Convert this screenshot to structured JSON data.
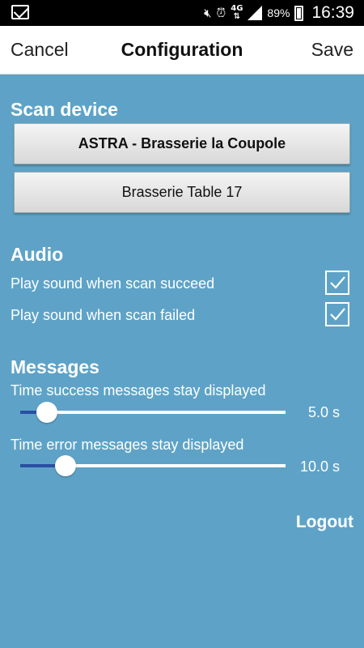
{
  "status_bar": {
    "battery_percent": "89%",
    "time": "16:39",
    "network": "4G",
    "icons": [
      "gmail-icon",
      "mute-icon",
      "alarm-icon",
      "network-4g-icon",
      "signal-icon",
      "battery-charging-icon"
    ]
  },
  "header": {
    "cancel_label": "Cancel",
    "title": "Configuration",
    "save_label": "Save"
  },
  "scan_device": {
    "title": "Scan device",
    "device_button": "ASTRA - Brasserie la Coupole",
    "table_button": "Brasserie Table 17"
  },
  "audio": {
    "title": "Audio",
    "items": [
      {
        "label": "Play sound when scan succeed",
        "checked": true
      },
      {
        "label": "Play sound when scan failed",
        "checked": true
      }
    ]
  },
  "messages": {
    "title": "Messages",
    "sliders": [
      {
        "label": "Time success messages stay displayed",
        "value": "5.0 s",
        "fraction": 0.1
      },
      {
        "label": "Time error messages stay displayed",
        "value": "10.0 s",
        "fraction": 0.17
      }
    ]
  },
  "logout_label": "Logout",
  "colors": {
    "background": "#5ea3c7",
    "slider_fill": "#2a4fa3",
    "header_bg": "#ffffff"
  }
}
